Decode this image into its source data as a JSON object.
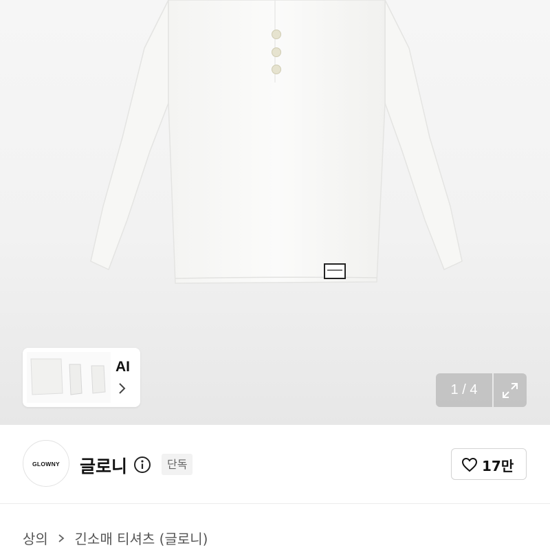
{
  "gallery": {
    "ai_label": "AI",
    "page_counter": "1 / 4",
    "icons": {
      "ai_chevron": "chevron-right-icon",
      "expand": "expand-icon"
    }
  },
  "brand": {
    "logo_text": "GLOWNY",
    "name": "글로니",
    "badge": "단독",
    "icons": {
      "info": "info-icon"
    }
  },
  "like": {
    "count": "17만",
    "icon": "heart-icon"
  },
  "breadcrumb": {
    "items": [
      "상의",
      "긴소매 티셔츠 (글로니)"
    ],
    "separator_icon": "chevron-right-icon"
  }
}
